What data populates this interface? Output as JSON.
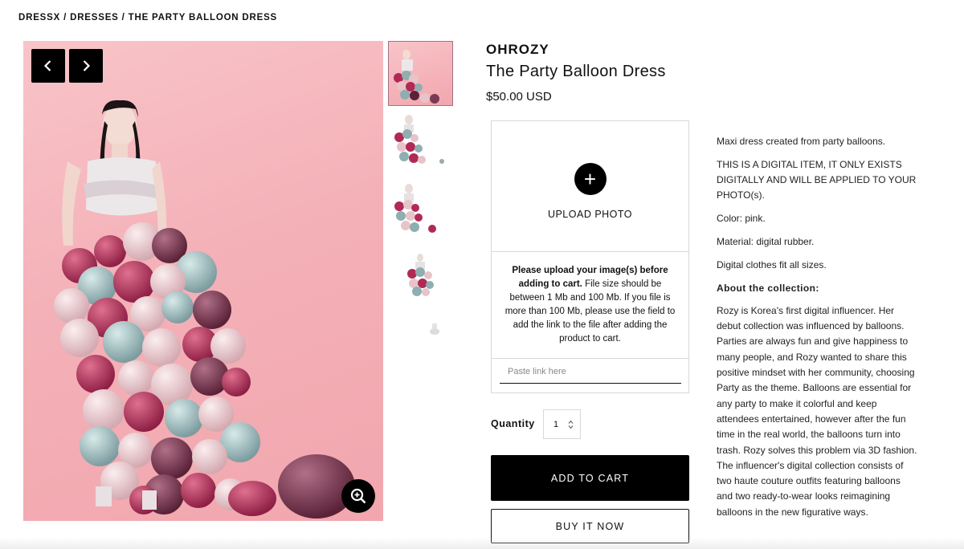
{
  "breadcrumb": {
    "part1": "DRESSX",
    "sep1": " / ",
    "part2": "DRESSES",
    "sep2": " / ",
    "part3": "THE PARTY BALLOON DRESS"
  },
  "product": {
    "brand": "OHROZY",
    "title": "The Party Balloon Dress",
    "price": "$50.00 USD"
  },
  "upload": {
    "label": "UPLOAD PHOTO",
    "plus": "+",
    "note_bold": "Please upload your image(s) before adding to cart.",
    "note_text": " File size should be between 1 Mb and 100 Mb. If you file is more than 100 Mb, please use the field to add the link to the file after adding the product to cart.",
    "link_placeholder": "Paste link here"
  },
  "quantity": {
    "label": "Quantity",
    "value": "1"
  },
  "buttons": {
    "add_to_cart": "ADD TO CART",
    "buy_now": "BUY IT NOW"
  },
  "description": {
    "p1": "Maxi dress created from party balloons.",
    "p2": "THIS IS A DIGITAL ITEM, IT ONLY EXISTS DIGITALLY AND WILL BE APPLIED TO YOUR PHOTO(s).",
    "p3": "Color: pink.",
    "p4": "Material: digital rubber.",
    "p5": "Digital clothes fit all sizes.",
    "heading": "About the collection:",
    "p6": "Rozy is Korea's first digital influencer. Her debut collection was influenced by balloons. Parties are always fun and give happiness to many people, and Rozy wanted to share this positive mindset with her community, choosing Party as the theme. Balloons are essential for any party to make it colorful and keep attendees entertained, however after the fun time in the real world, the balloons turn into trash. Rozy solves this problem via 3D fashion. The influencer's digital collection consists of two haute couture outfits featuring balloons and two ready-to-wear looks reimagining balloons in the new figurative ways."
  },
  "icons": {
    "prev": "chevron-left-icon",
    "next": "chevron-right-icon",
    "zoom": "zoom-in-icon",
    "stepper": "up-down-arrows-icon"
  },
  "colors": {
    "accent": "#000000",
    "image_bg": "#f4b1b8",
    "balloon_crimson": "#b02a55",
    "balloon_teal": "#8eaeb0",
    "balloon_blush": "#e6c4c8",
    "thumb_border": "#a67088"
  }
}
